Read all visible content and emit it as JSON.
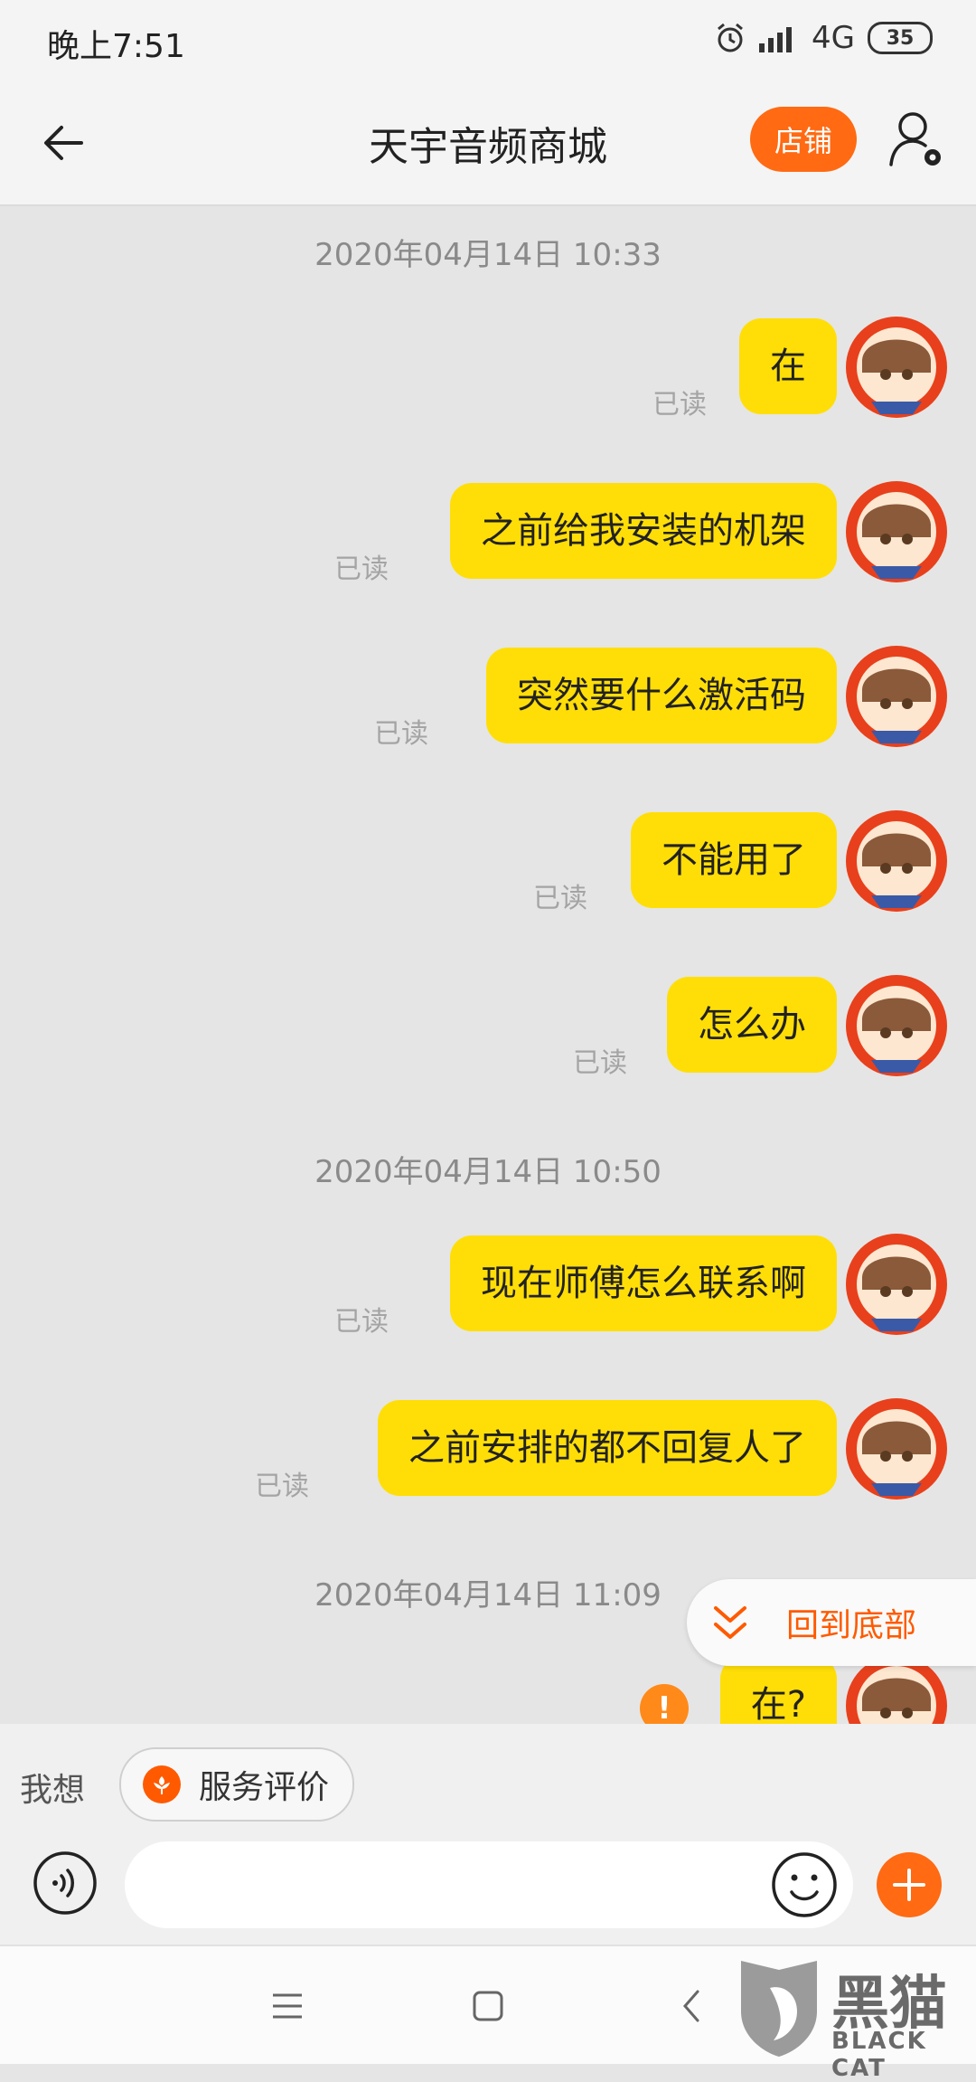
{
  "status_bar": {
    "time": "晚上7:51",
    "network": "4G",
    "battery": "35"
  },
  "header": {
    "title": "天宇音频商城",
    "shop_button": "店铺"
  },
  "messages": [
    {
      "text": "在",
      "read": "已读"
    },
    {
      "text": "之前给我安装的机架",
      "read": "已读"
    },
    {
      "text": "突然要什么激活码",
      "read": "已读"
    },
    {
      "text": "不能用了",
      "read": "已读"
    },
    {
      "text": "怎么办",
      "read": "已读"
    },
    {
      "text": "现在师傅怎么联系啊",
      "read": "已读"
    },
    {
      "text": "之前安排的都不回复人了",
      "read": "已读"
    },
    {
      "text": "在?",
      "read": ""
    }
  ],
  "timestamps": [
    "2020年04月14日 10:33",
    "2020年04月14日 10:50",
    "2020年04月14日 11:09"
  ],
  "failed_icon": "!",
  "jump_to_bottom": "回到底部",
  "quick_bar": {
    "prefix": "我想",
    "chip_label": "服务评价"
  },
  "watermark": {
    "cn": "黑猫",
    "en": "BLACK CAT"
  },
  "colors": {
    "accent": "#ff6a12",
    "bubble": "#ffde07",
    "chat_bg": "#e5e5e5"
  }
}
